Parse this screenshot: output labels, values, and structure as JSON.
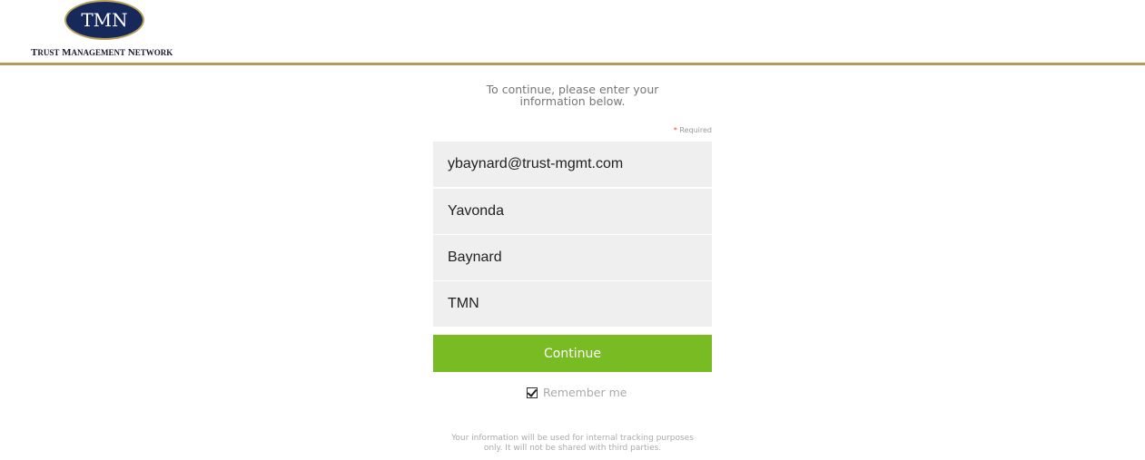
{
  "brand": {
    "logo_text": "TMN",
    "name": "Trust Management Network",
    "colors": {
      "navy": "#17295b",
      "gold": "#b39a5e"
    }
  },
  "form": {
    "intro_line1": "To continue, please enter your",
    "intro_line2": "information below.",
    "required_star": "*",
    "required_label": "Required",
    "fields": [
      {
        "name": "email",
        "value": "ybaynard@trust-mgmt.com"
      },
      {
        "name": "first_name",
        "value": "Yavonda"
      },
      {
        "name": "last_name",
        "value": "Baynard"
      },
      {
        "name": "company",
        "value": "TMN"
      }
    ],
    "continue_label": "Continue",
    "continue_color": "#79bb22",
    "remember_label": "Remember me",
    "remember_checked": true
  },
  "footer": {
    "line1": "Your information will be used for internal tracking purposes",
    "line2": "only. It will not be shared with third parties."
  }
}
